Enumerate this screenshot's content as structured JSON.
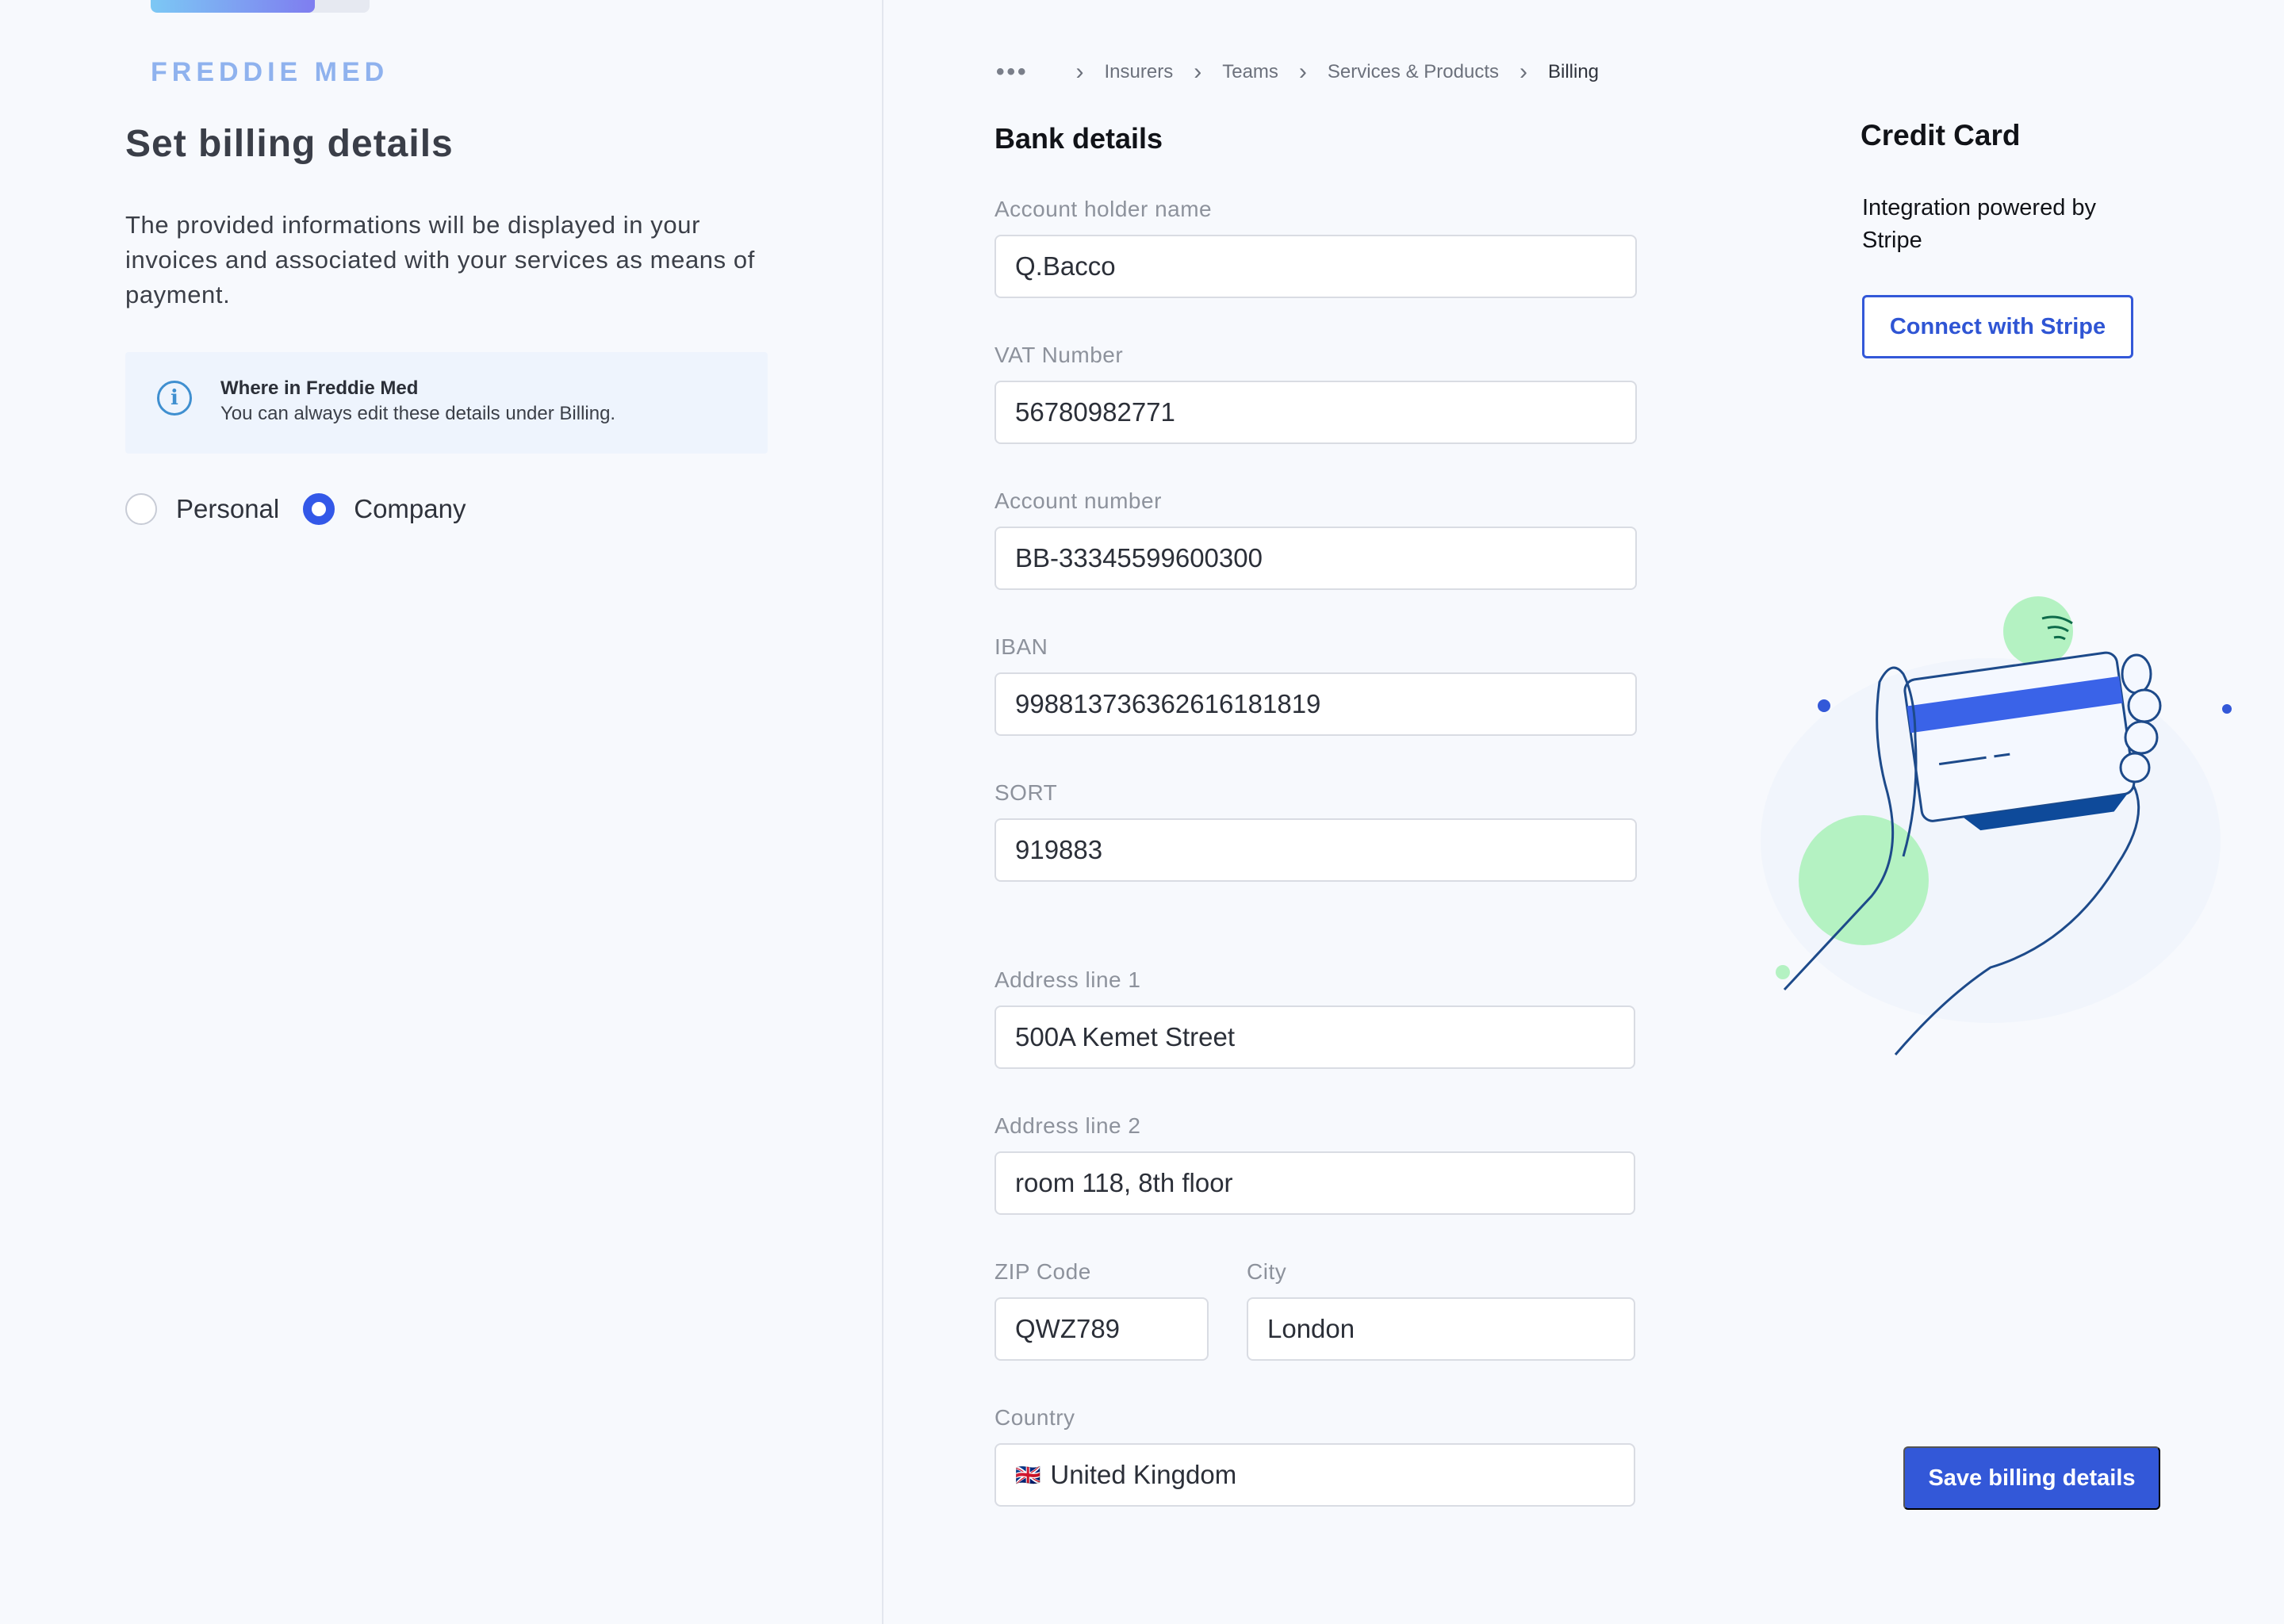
{
  "progress": {
    "fraction": 0.75
  },
  "left": {
    "logo": "FREDDIE MED",
    "title": "Set billing details",
    "description": "The provided informations will be displayed in your invoices and associated with your services as means of payment.",
    "info": {
      "title": "Where in Freddie Med",
      "text": "You can always edit these details under Billing."
    },
    "account_type": {
      "options": [
        "Personal",
        "Company"
      ],
      "selected": "Company"
    }
  },
  "breadcrumb": {
    "items": [
      "Insurers",
      "Teams",
      "Services & Products",
      "Billing"
    ]
  },
  "bank": {
    "title": "Bank details",
    "account_holder": {
      "label": "Account holder name",
      "value": "Q.Bacco"
    },
    "vat": {
      "label": "VAT Number",
      "value": "56780982771"
    },
    "account_number": {
      "label": "Account number",
      "value": "BB-33345599600300"
    },
    "iban": {
      "label": "IBAN",
      "value": "998813736362616181819"
    },
    "sort": {
      "label": "SORT",
      "value": "919883"
    }
  },
  "address": {
    "line1": {
      "label": "Address line 1",
      "value": "500A Kemet Street"
    },
    "line2": {
      "label": "Address line 2",
      "value": "room 118, 8th floor"
    },
    "zip": {
      "label": "ZIP Code",
      "value": "QWZ789"
    },
    "city": {
      "label": "City",
      "value": "London"
    },
    "country": {
      "label": "Country",
      "value": "United Kingdom",
      "flag": "🇬🇧"
    }
  },
  "credit_card": {
    "title": "Credit Card",
    "description": "Integration powered by Stripe",
    "connect_label": "Connect with Stripe"
  },
  "actions": {
    "save_label": "Save billing details"
  },
  "colors": {
    "primary": "#3358d8",
    "accent_green": "#b4f2c2",
    "info_bg": "#eef4fd"
  }
}
